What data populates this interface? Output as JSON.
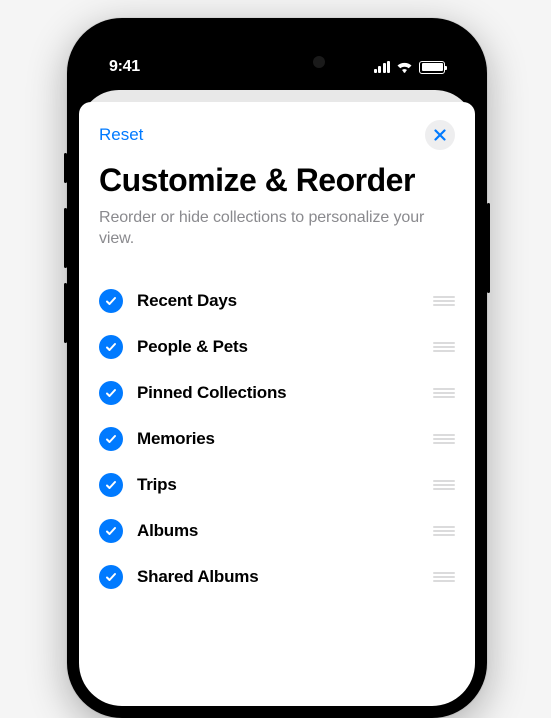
{
  "status_bar": {
    "time": "9:41"
  },
  "sheet": {
    "reset_label": "Reset",
    "title": "Customize & Reorder",
    "subtitle": "Reorder or hide collections to personalize your view."
  },
  "items": [
    {
      "label": "Recent Days",
      "checked": true
    },
    {
      "label": "People & Pets",
      "checked": true
    },
    {
      "label": "Pinned Collections",
      "checked": true
    },
    {
      "label": "Memories",
      "checked": true
    },
    {
      "label": "Trips",
      "checked": true
    },
    {
      "label": "Albums",
      "checked": true
    },
    {
      "label": "Shared Albums",
      "checked": true
    }
  ]
}
